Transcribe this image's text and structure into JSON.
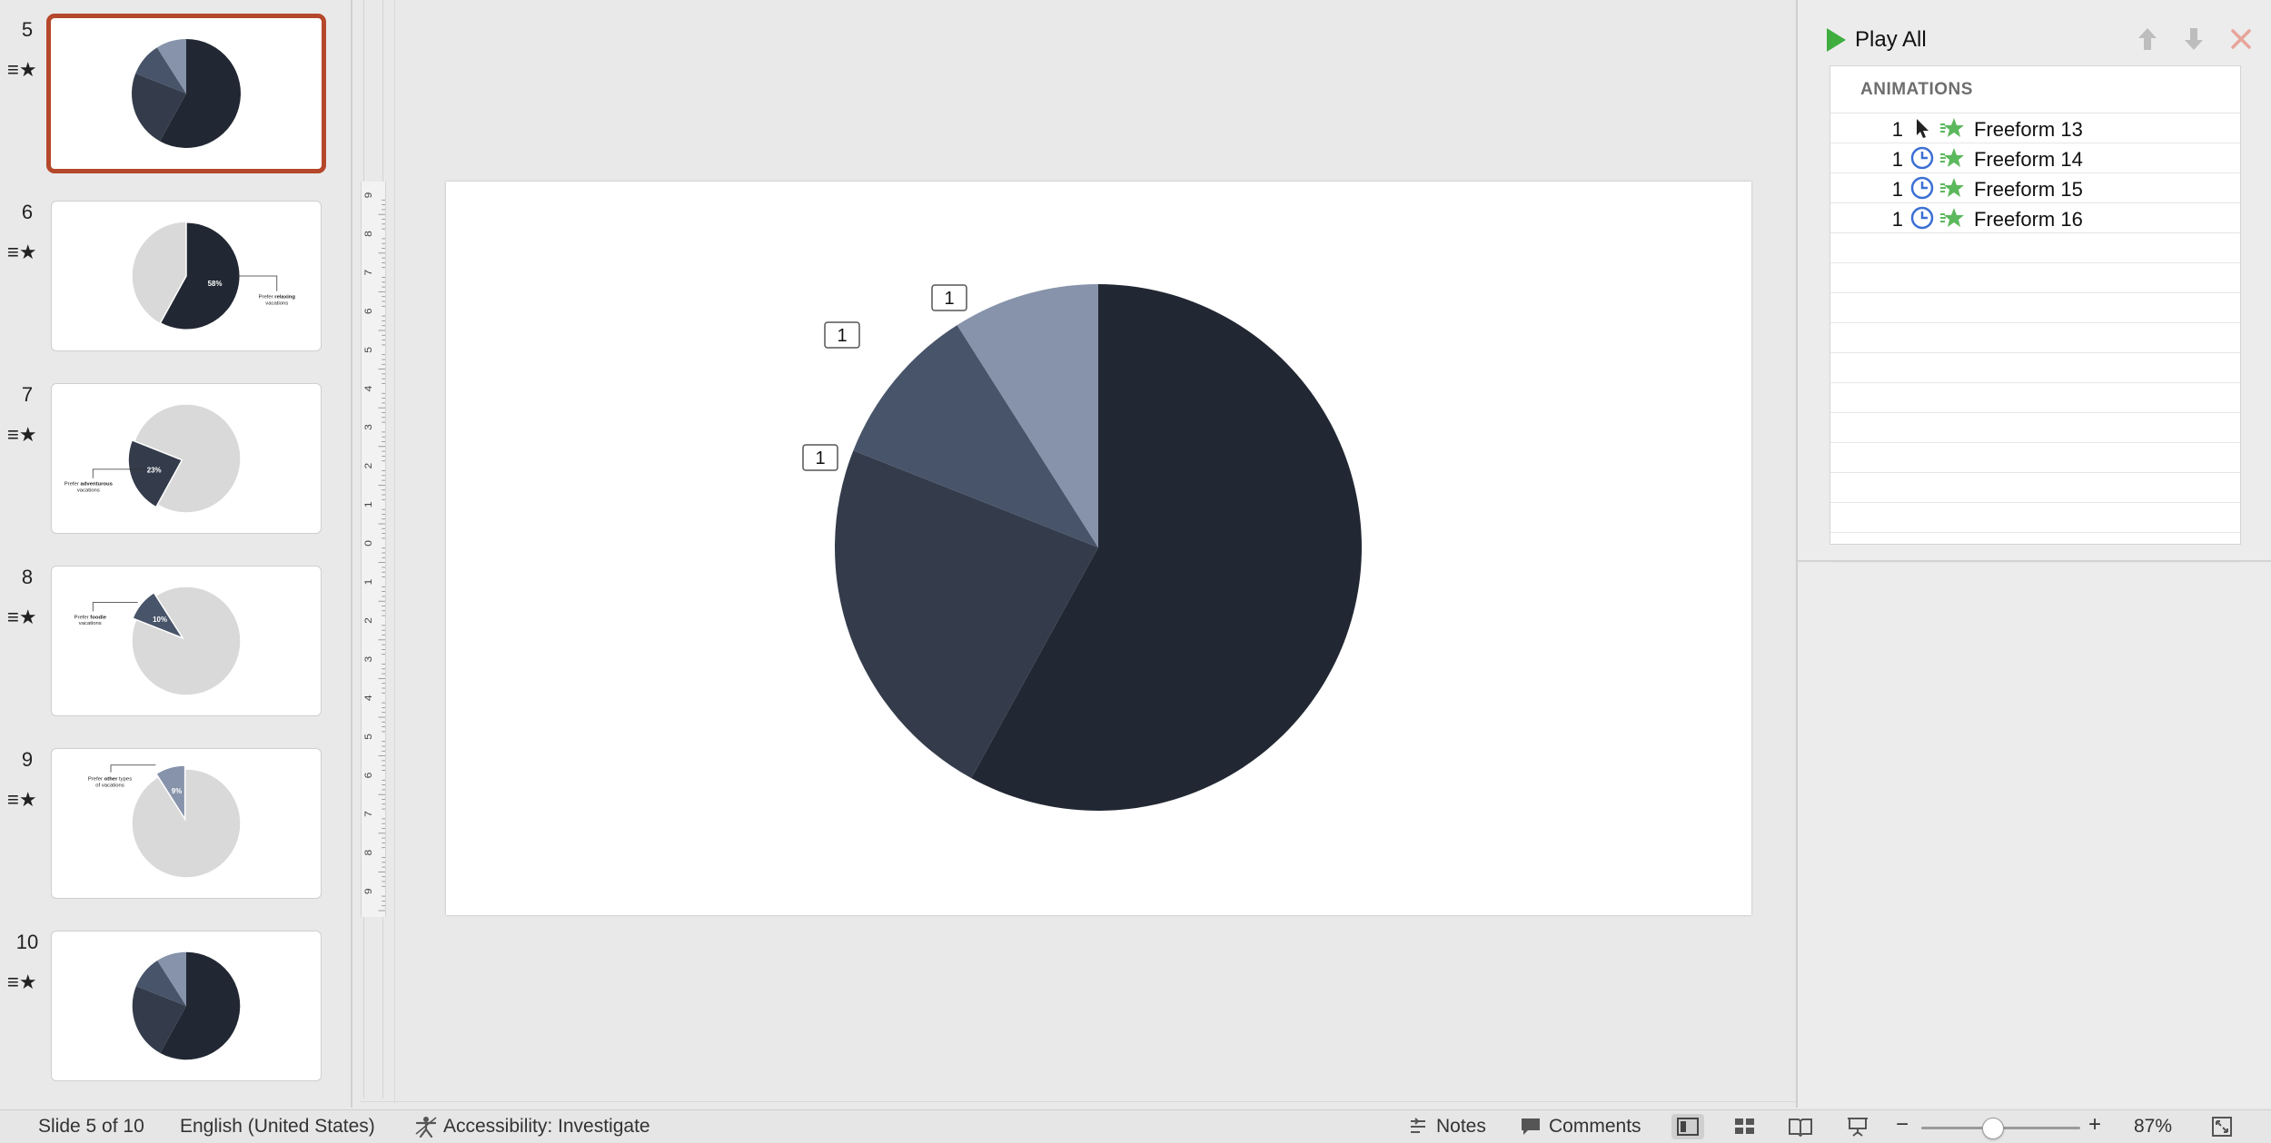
{
  "thumbnails": [
    {
      "num": "5",
      "star": "≡★",
      "selected": true,
      "variant": "full"
    },
    {
      "num": "6",
      "star": "≡★",
      "selected": false,
      "variant": "slice1",
      "pct": "58%",
      "caption1": "Prefer ",
      "caption_bold": "relaxing",
      "caption2": "vacations"
    },
    {
      "num": "7",
      "star": "≡★",
      "selected": false,
      "variant": "slice2",
      "pct": "23%",
      "caption1": "Prefer ",
      "caption_bold": "adventurous",
      "caption2": "vacations"
    },
    {
      "num": "8",
      "star": "≡★",
      "selected": false,
      "variant": "slice3",
      "pct": "10%",
      "caption1": "Prefer ",
      "caption_bold": "foodie",
      "caption2": "vacations"
    },
    {
      "num": "9",
      "star": "≡★",
      "selected": false,
      "variant": "slice4",
      "pct": "9%",
      "caption1": "Prefer ",
      "caption_bold": "other",
      "caption_after": " types",
      "caption2": "of vacations"
    },
    {
      "num": "10",
      "star": "≡★",
      "selected": false,
      "variant": "full"
    }
  ],
  "ruler": {
    "labels": [
      "9",
      "8",
      "7",
      "6",
      "5",
      "4",
      "3",
      "2",
      "1",
      "0",
      "1",
      "2",
      "3",
      "4",
      "5",
      "6",
      "7",
      "8",
      "9"
    ]
  },
  "slide": {
    "tags": [
      "1",
      "1",
      "1"
    ]
  },
  "chart_data": {
    "type": "pie",
    "slices": [
      {
        "value": 58,
        "color": "#222833"
      },
      {
        "value": 23,
        "color": "#343c4b"
      },
      {
        "value": 10,
        "color": "#485469"
      },
      {
        "value": 9,
        "color": "#8693aa"
      }
    ]
  },
  "animation_pane": {
    "play_all_label": "Play All",
    "header": "ANIMATIONS",
    "items": [
      {
        "index": "1",
        "trigger": "click",
        "name": "Freeform 13"
      },
      {
        "index": "1",
        "trigger": "clock",
        "name": "Freeform 14"
      },
      {
        "index": "1",
        "trigger": "clock",
        "name": "Freeform 15"
      },
      {
        "index": "1",
        "trigger": "clock",
        "name": "Freeform 16"
      }
    ],
    "empty_rows": 11
  },
  "status_bar": {
    "slide_info": "Slide 5 of 10",
    "language": "English (United States)",
    "accessibility": "Accessibility: Investigate",
    "notes": "Notes",
    "comments": "Comments",
    "zoom_minus": "−",
    "zoom_plus": "+",
    "zoom_level": "87%",
    "zoom_fraction": 0.45
  },
  "colors": {
    "accent_selected": "#b5472b",
    "play_green": "#3fae3f",
    "effect_green": "#5cb85c",
    "clock_blue": "#3b6fd4",
    "thumb_grey": "#d9d9d9"
  }
}
